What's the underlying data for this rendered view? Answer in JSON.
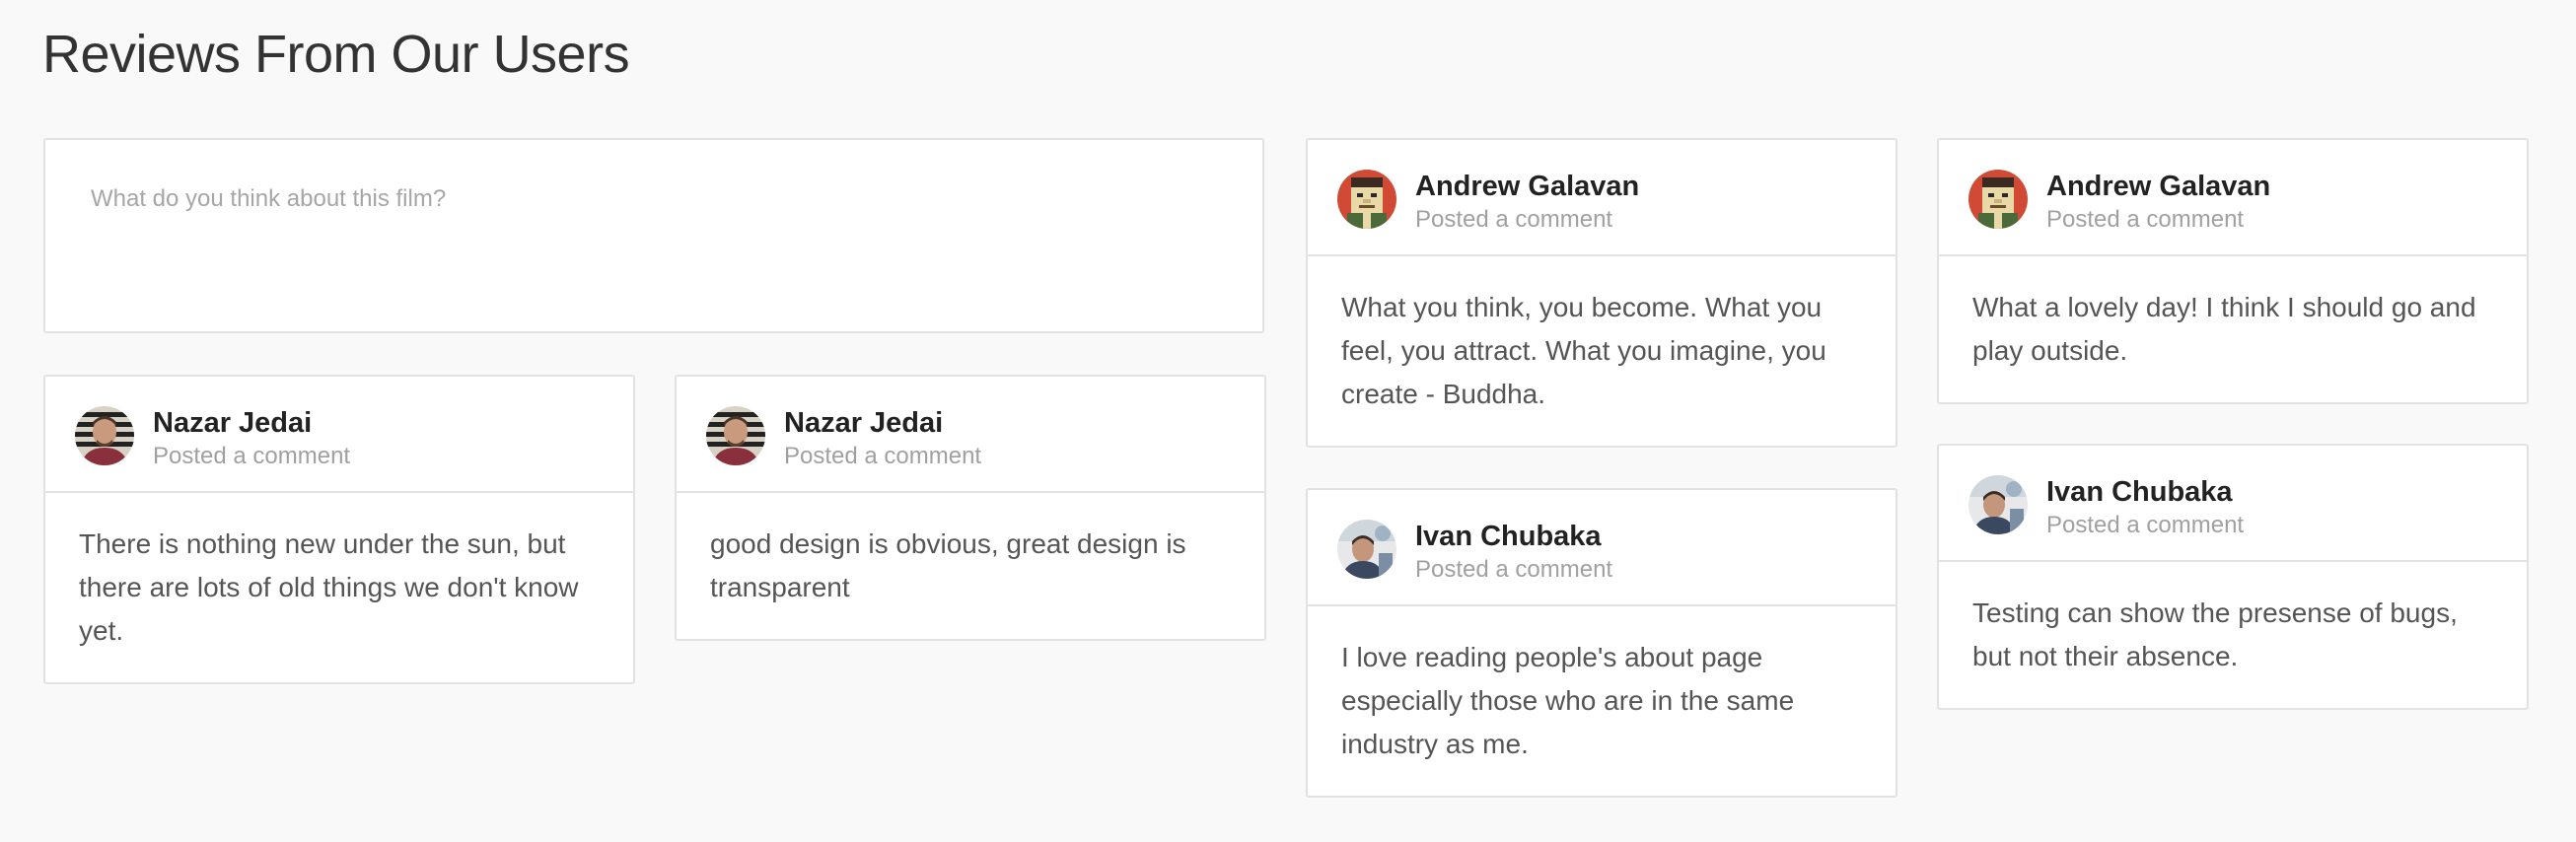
{
  "page": {
    "title": "Reviews From Our Users"
  },
  "composer": {
    "placeholder": "What do you think about this film?"
  },
  "reviews": [
    {
      "author": "Nazar Jedai",
      "meta": "Posted a comment",
      "avatar": "person-photo-avatar",
      "text": "There is nothing new under the sun, but there are lots of old things we don't know yet."
    },
    {
      "author": "Nazar Jedai",
      "meta": "Posted a comment",
      "avatar": "person-photo-avatar",
      "text": "good design is obvious, great design is transparent"
    },
    {
      "author": "Andrew Galavan",
      "meta": "Posted a comment",
      "avatar": "pixel-art-avatar",
      "text": "What you think, you become. What you feel, you attract. What you imagine, you create - Buddha."
    },
    {
      "author": "Ivan Chubaka",
      "meta": "Posted a comment",
      "avatar": "person-photo-avatar",
      "text": "I love reading people's about page especially those who are in the same industry as me."
    },
    {
      "author": "Andrew Galavan",
      "meta": "Posted a comment",
      "avatar": "pixel-art-avatar",
      "text": "What a lovely day! I think I should go and play outside."
    },
    {
      "author": "Ivan Chubaka",
      "meta": "Posted a comment",
      "avatar": "person-photo-avatar",
      "text": "Testing can show the presense of bugs, but not their absence."
    }
  ],
  "colors": {
    "background": "#f9f9f9",
    "card_border": "#e2e2e2",
    "author_text": "#222222",
    "meta_text": "#a0a0a0",
    "body_text": "#555555"
  }
}
